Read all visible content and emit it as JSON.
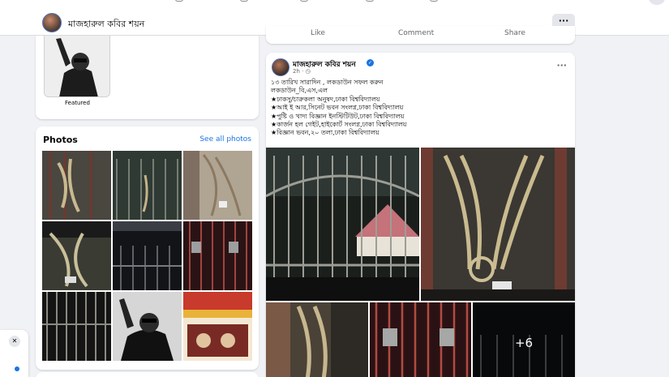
{
  "header": {
    "profile_name": "মাজহারুল কবির শয়ন",
    "more_label": "···"
  },
  "featured": {
    "label": "Featured"
  },
  "photos": {
    "title": "Photos",
    "see_all": "See all photos",
    "count": 9
  },
  "post_actions": {
    "like": "Like",
    "comment": "Comment",
    "share": "Share"
  },
  "post": {
    "author": "মাজহারুল কবির শয়ন",
    "verified_icon": "verified-badge-icon",
    "time": "2h · ",
    "more_label": "···",
    "lines": [
      "১৩ তারিখ সারাদিন , লকডাউন সফল করুন",
      "লকডাউন_বি,এস,এল",
      "★ঢাকসু/চারুকলা অনুষদ,ঢাকা বিশ্ববিদ্যালয়",
      "★আই ই আর,সিনেট ভবন সংলগ্ন,ঢাকা বিশ্ববিদ্যালয়",
      "★পুষ্টি ও খাদ্য বিজ্ঞান ইনস্টিটিউট,ঢাকা বিশ্ববিদ্যালয়",
      "★কার্জন হল গেইট,হাইকোর্ট সংলগ্ন,ঢাকা বিশ্ববিদ্যালয়",
      "★বিজ্ঞান ভবন,২০ তলা,ঢাকা বিশ্ববিদ্যালয়"
    ],
    "more_photos": "+6"
  },
  "chat": {
    "close_label": "✕"
  },
  "colors": {
    "accent": "#1b74e4",
    "background": "#f0f2f5",
    "card": "#ffffff",
    "secondary_text": "#65676b"
  }
}
